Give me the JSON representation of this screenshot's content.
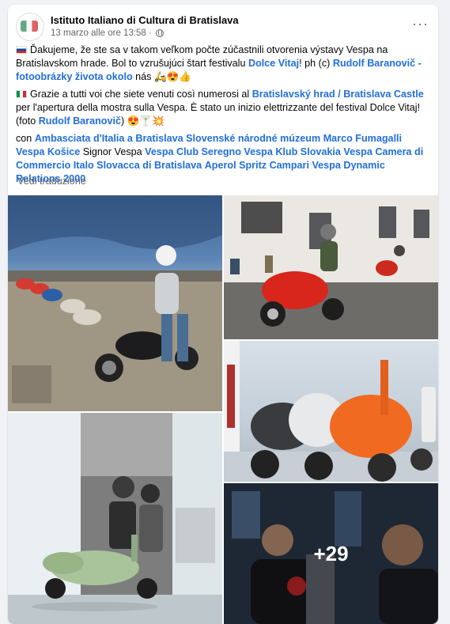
{
  "post": {
    "page_name": "Istituto Italiano di Cultura di Bratislava",
    "date": "13 marzo alle ore 13:58 ·",
    "avatar_text": "ISTITUTO ITALIANO DI CULTURA",
    "more_options": "···"
  },
  "para1": {
    "t1": "Ďakujeme, že ste sa v takom veľkom počte zúčastnili otvorenia výstavy Vespa na Bratislavskom hrade. Bol to vzrušujúci štart festivalu ",
    "l1": "Dolce Vitaj",
    "t2": "! ph (c) ",
    "l2": "Rudolf Baranovič - fotoobrázky života okolo",
    "t3": " nás 🛵😍👍"
  },
  "para2": {
    "t1": "Grazie a tutti voi che siete venuti così numerosi al ",
    "l1": "Bratislavský hrad / Bratislava Castle",
    "t2": " per l'apertura della mostra sulla Vespa. È stato un inizio elettrizzante del festival Dolce Vitaj! (foto ",
    "l2": "Rudolf Baranovič",
    "t3": ") 😍🍸💥"
  },
  "para3": {
    "t1": "con  ",
    "l1": "Ambasciata d'Italia a Bratislava",
    "l2": "Slovenské národné múzeum",
    "l3": "Marco Fumagalli",
    "l4": "Vespa Košice",
    "t2": " Signor Vespa ",
    "l5": "Vespa Club Seregno",
    "l6": "Vespa Klub Slovakia",
    "l7": "Vespa Camera di Commercio Italo Slovacca di Bratislava",
    "l8": "Aperol Spritz",
    "l9": "Campari",
    "l10": "Vespa Dynamic Relations 2000"
  },
  "translate_label": "Vedi traduzione",
  "photos": {
    "more_count": "+29"
  },
  "colors": {
    "link": "#216fdb",
    "muted": "#65676b",
    "background": "#f0f2f5"
  }
}
